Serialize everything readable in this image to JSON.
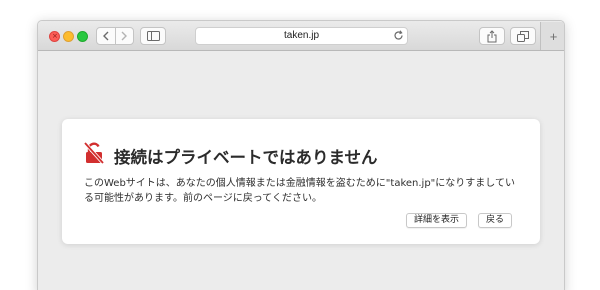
{
  "browser": {
    "address": "taken.jp",
    "new_tab_label": "+",
    "icons": {
      "back": "chevron-left-icon",
      "forward": "chevron-right-icon",
      "sidebar": "sidebar-icon",
      "reload": "reload-icon",
      "share": "share-icon",
      "tabs": "tabs-overview-icon"
    }
  },
  "warning": {
    "title": "接続はプライベートではありません",
    "message": "このWebサイトは、あなたの個人情報または金融情報を盗むために\"taken.jp\"になりすましている可能性があります。前のページに戻ってください。",
    "details_button": "詳細を表示",
    "back_button": "戻る",
    "icon": "broken-lock-icon",
    "icon_color": "#d22f2f"
  }
}
